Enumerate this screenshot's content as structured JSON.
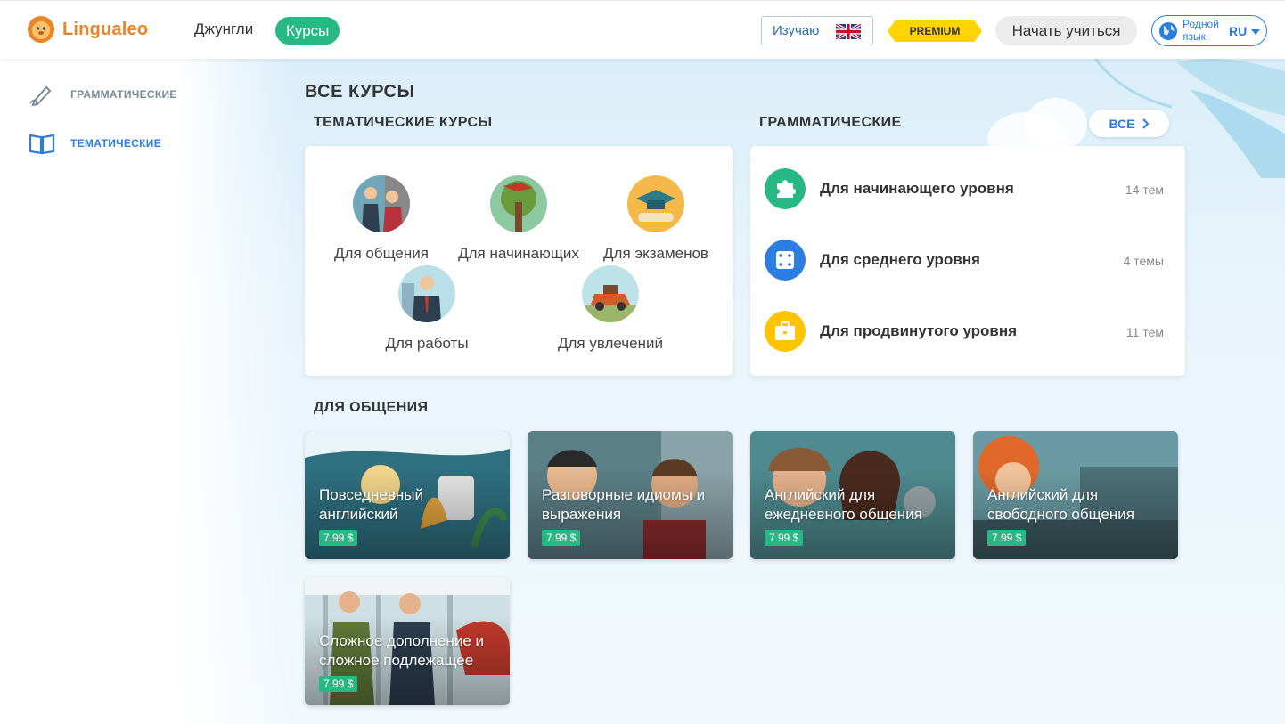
{
  "header": {
    "logo_text": "Lingualeo",
    "nav_jungle": "Джунгли",
    "nav_courses": "Курсы",
    "learning_label": "Изучаю",
    "learning_flag": "uk-flag-icon",
    "premium": "PREMIUM",
    "start_button": "Начать учиться",
    "native_lang_label": "Родной язык:",
    "native_lang_code": "RU"
  },
  "sidebar": {
    "items": [
      {
        "label": "ГРАММАТИЧЕСКИЕ",
        "icon": "pen-icon"
      },
      {
        "label": "ТЕМАТИЧЕСКИЕ",
        "icon": "book-icon"
      }
    ]
  },
  "main": {
    "title": "ВСЕ КУРСЫ",
    "thematic": {
      "heading": "ТЕМАТИЧЕСКИЕ КУРСЫ",
      "items": [
        {
          "label": "Для общения"
        },
        {
          "label": "Для начинающих"
        },
        {
          "label": "Для экзаменов"
        },
        {
          "label": "Для работы"
        },
        {
          "label": "Для увлечений"
        }
      ]
    },
    "grammar": {
      "heading": "ГРАММАТИЧЕСКИЕ",
      "all_button": "ВСЕ",
      "items": [
        {
          "label": "Для начинающего уровня",
          "count": "14 тем",
          "icon": "puzzle-icon",
          "color": "#27b884"
        },
        {
          "label": "Для среднего уровня",
          "count": "4 темы",
          "icon": "dice-icon",
          "color": "#2b7de0"
        },
        {
          "label": "Для продвинутого уровня",
          "count": "11 тем",
          "icon": "briefcase-icon",
          "color": "#ffc400"
        }
      ]
    },
    "communication": {
      "heading": "ДЛЯ ОБЩЕНИЯ",
      "courses": [
        {
          "title": "Повседневный английский",
          "price": "7.99 $"
        },
        {
          "title": "Разговорные идиомы и выражения",
          "price": "7.99 $"
        },
        {
          "title": "Английский для ежедневного общения",
          "price": "7.99 $"
        },
        {
          "title": "Английский для свободного общения",
          "price": "7.99 $"
        },
        {
          "title": "Сложное дополнение и сложное подлежащее",
          "price": "7.99 $"
        }
      ]
    }
  },
  "colors": {
    "accent_green": "#27b884",
    "accent_blue": "#2b7de0",
    "logo_orange": "#e8852b",
    "premium_yellow": "#ffd400"
  }
}
